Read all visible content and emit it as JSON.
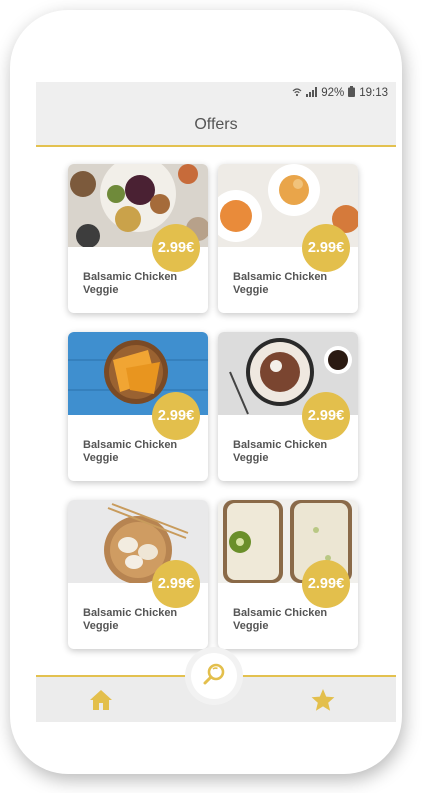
{
  "statusbar": {
    "battery": "92%",
    "time": "19:13"
  },
  "header": {
    "title": "Offers"
  },
  "offers": [
    {
      "name": "Balsamic Chicken Veggie",
      "price": "2.99€"
    },
    {
      "name": "Balsamic Chicken Veggie",
      "price": "2.99€"
    },
    {
      "name": "Balsamic Chicken Veggie",
      "price": "2.99€"
    },
    {
      "name": "Balsamic Chicken Veggie",
      "price": "2.99€"
    },
    {
      "name": "Balsamic Chicken Veggie",
      "price": "2.99€"
    },
    {
      "name": "Balsamic Chicken Veggie",
      "price": "2.99€"
    }
  ],
  "nav": {
    "home_icon": "home-icon",
    "search_icon": "search-icon",
    "favorites_icon": "star-icon"
  },
  "colors": {
    "accent": "#e3bf4c",
    "bar": "#efefef",
    "text": "#555555"
  }
}
